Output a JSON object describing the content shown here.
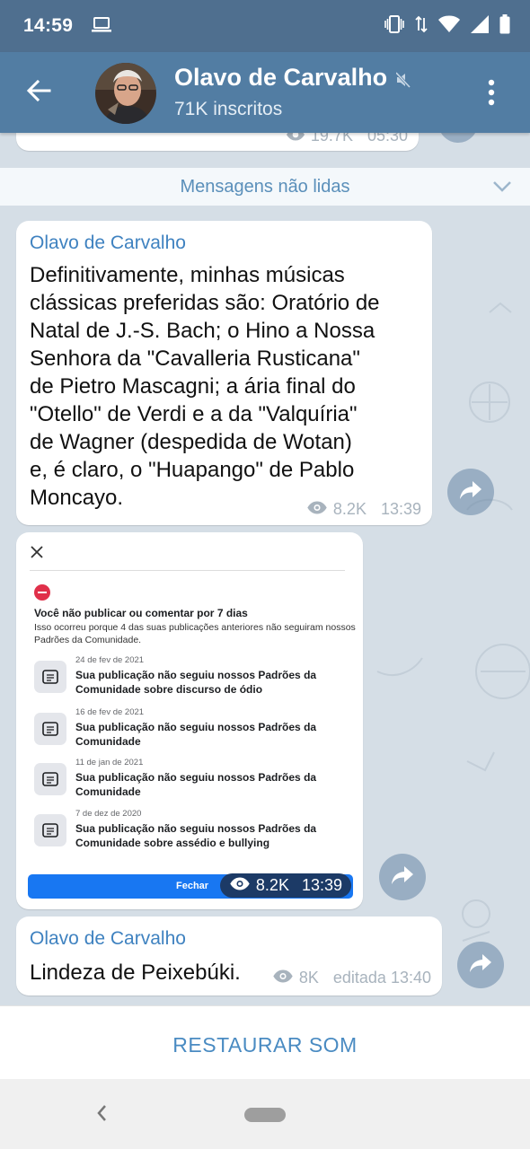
{
  "status_bar": {
    "time": "14:59",
    "icons": [
      "laptop-icon",
      "vibrate-icon",
      "data-arrows-icon",
      "wifi-icon",
      "signal-icon",
      "battery-icon"
    ]
  },
  "header": {
    "title": "Olavo de Carvalho",
    "subtitle": "71K inscritos",
    "muted": true,
    "icons": [
      "back-arrow-icon",
      "mute-icon",
      "more-vert-icon"
    ]
  },
  "chat": {
    "previous_message": {
      "views": "19.7K",
      "time": "05:30"
    },
    "unread_label": "Mensagens não lidas",
    "messages": [
      {
        "sender": "Olavo de Carvalho",
        "text": "Definitivamente, minhas músicas\nclássicas preferidas são: Oratório de\nNatal de J.-S. Bach; o Hino a Nossa\nSenhora da \"Cavalleria Rusticana\"\nde Pietro Mascagni; a ária final do\n\"Otello\" de Verdi e a da \"Valquíria\"\nde Wagner (despedida de Wotan)\ne, é claro, o \"Huapango\" de Pablo\nMoncayo.",
        "views": "8.2K",
        "time": "13:39"
      },
      {
        "type": "image",
        "views": "8.2K",
        "time": "13:39",
        "image_content": {
          "heading": "Você não publicar ou comentar por 7 dias",
          "description": "Isso ocorreu porque 4 das suas publicações anteriores não seguiram nossos Padrões da Comunidade.",
          "violations": [
            {
              "date": "24 de fev de 2021",
              "text": "Sua publicação não seguiu nossos Padrões da Comunidade sobre discurso de ódio"
            },
            {
              "date": "16 de fev de 2021",
              "text": "Sua publicação não seguiu nossos Padrões da Comunidade"
            },
            {
              "date": "11 de jan de 2021",
              "text": "Sua publicação não seguiu nossos Padrões da Comunidade"
            },
            {
              "date": "7 de dez de 2020",
              "text": "Sua publicação não seguiu nossos Padrões da Comunidade sobre assédio e bullying"
            }
          ],
          "button": "Fechar"
        }
      },
      {
        "sender": "Olavo de Carvalho",
        "text": "Lindeza de Peixebúki.",
        "views": "8K",
        "edited_time": "editada 13:40"
      }
    ]
  },
  "bottom": {
    "restore_label": "RESTAURAR SOM"
  },
  "colors": {
    "header": "#527da3",
    "status_bar": "#4f6f8f",
    "chat_bg": "#d5dee6",
    "accent": "#3f82c0"
  }
}
